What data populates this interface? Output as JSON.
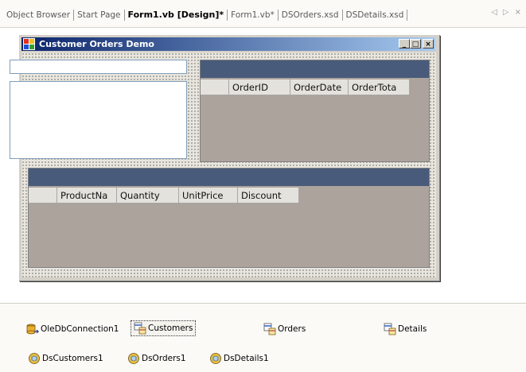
{
  "tabs": [
    {
      "label": "Object Browser",
      "active": false
    },
    {
      "label": "Start Page",
      "active": false
    },
    {
      "label": "Form1.vb [Design]*",
      "active": true
    },
    {
      "label": "Form1.vb*",
      "active": false
    },
    {
      "label": "DSOrders.xsd",
      "active": false
    },
    {
      "label": "DSDetails.xsd",
      "active": false
    }
  ],
  "tab_controls": {
    "prev": "◁",
    "next": "▷",
    "close": "×"
  },
  "form": {
    "title": "Customer Orders Demo",
    "caption_buttons": {
      "minimize": "_",
      "maximize": "□",
      "close": "×"
    }
  },
  "orders_grid": {
    "columns": [
      "OrderID",
      "OrderDate",
      "OrderTota"
    ]
  },
  "details_grid": {
    "columns": [
      "ProductNa",
      "Quantity",
      "UnitPrice",
      "Discount"
    ]
  },
  "components": {
    "oledb": "OleDbConnection1",
    "customers": "Customers",
    "orders": "Orders",
    "details": "Details",
    "dscustomers": "DsCustomers1",
    "dsorders": "DsOrders1",
    "dsdetails": "DsDetails1"
  },
  "colors": {
    "grid_caption": "#495b7a",
    "grid_background": "#aba39c",
    "titlebar_start": "#0a246a",
    "titlebar_end": "#a6caf0"
  }
}
